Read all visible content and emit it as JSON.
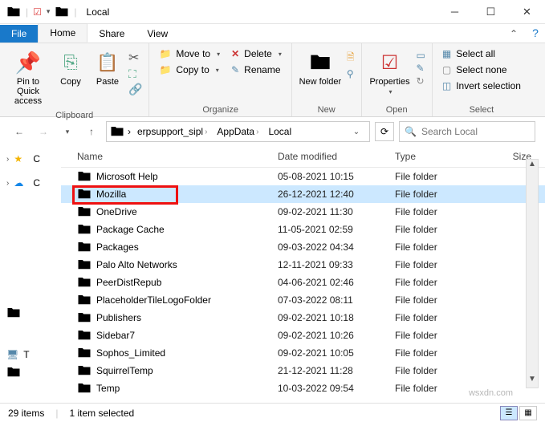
{
  "window": {
    "title": "Local"
  },
  "tabs": {
    "file": "File",
    "home": "Home",
    "share": "Share",
    "view": "View"
  },
  "ribbon": {
    "clipboard": {
      "pin": "Pin to Quick access",
      "copy": "Copy",
      "paste": "Paste",
      "label": "Clipboard"
    },
    "organize": {
      "moveto": "Move to",
      "copyto": "Copy to",
      "delete": "Delete",
      "rename": "Rename",
      "label": "Organize"
    },
    "new": {
      "newfolder": "New folder",
      "label": "New"
    },
    "open": {
      "properties": "Properties",
      "label": "Open"
    },
    "select": {
      "all": "Select all",
      "none": "Select none",
      "invert": "Invert selection",
      "label": "Select"
    }
  },
  "breadcrumbs": [
    "erpsupport_sipl",
    "AppData",
    "Local"
  ],
  "search": {
    "placeholder": "Search Local"
  },
  "navpane": {
    "quick": "C",
    "onedrive": "C"
  },
  "columns": {
    "name": "Name",
    "date": "Date modified",
    "type": "Type",
    "size": "Size"
  },
  "files": [
    {
      "name": "Microsoft Help",
      "date": "05-08-2021 10:15",
      "type": "File folder"
    },
    {
      "name": "Mozilla",
      "date": "26-12-2021 12:40",
      "type": "File folder",
      "selected": true,
      "highlighted": true
    },
    {
      "name": "OneDrive",
      "date": "09-02-2021 11:30",
      "type": "File folder"
    },
    {
      "name": "Package Cache",
      "date": "11-05-2021 02:59",
      "type": "File folder"
    },
    {
      "name": "Packages",
      "date": "09-03-2022 04:34",
      "type": "File folder"
    },
    {
      "name": "Palo Alto Networks",
      "date": "12-11-2021 09:33",
      "type": "File folder"
    },
    {
      "name": "PeerDistRepub",
      "date": "04-06-2021 02:46",
      "type": "File folder"
    },
    {
      "name": "PlaceholderTileLogoFolder",
      "date": "07-03-2022 08:11",
      "type": "File folder"
    },
    {
      "name": "Publishers",
      "date": "09-02-2021 10:18",
      "type": "File folder"
    },
    {
      "name": "Sidebar7",
      "date": "09-02-2021 10:26",
      "type": "File folder"
    },
    {
      "name": "Sophos_Limited",
      "date": "09-02-2021 10:05",
      "type": "File folder"
    },
    {
      "name": "SquirrelTemp",
      "date": "21-12-2021 11:28",
      "type": "File folder"
    },
    {
      "name": "Temp",
      "date": "10-03-2022 09:54",
      "type": "File folder"
    }
  ],
  "status": {
    "count": "29 items",
    "selected": "1 item selected"
  },
  "watermark": "wsxdn.com"
}
